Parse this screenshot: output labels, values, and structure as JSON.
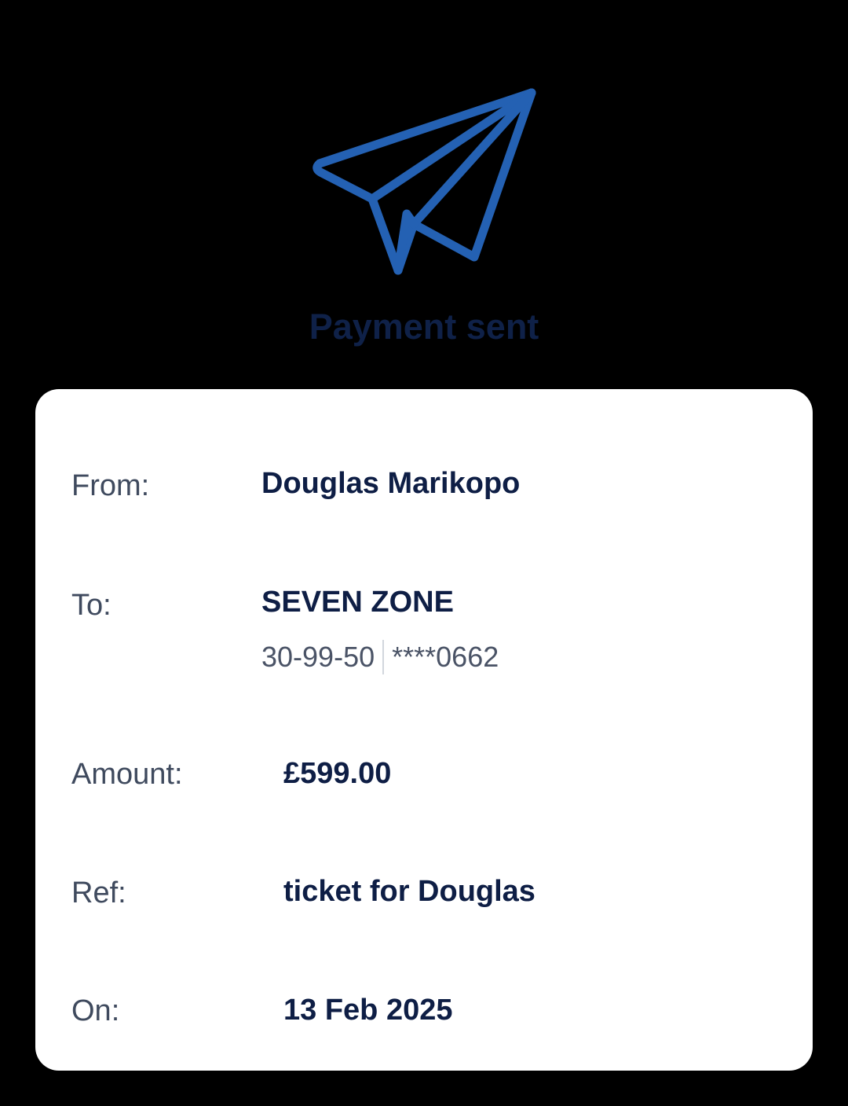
{
  "header": {
    "icon": "paper-plane-icon",
    "title": "Payment sent"
  },
  "colors": {
    "icon_blue": "#2461b3",
    "title_navy": "#0f2148",
    "value_navy": "#0e1e45",
    "label_gray": "#3f4a5e",
    "background": "#000000",
    "card": "#ffffff"
  },
  "details": {
    "from": {
      "label": "From:",
      "value": "Douglas Marikopo"
    },
    "to": {
      "label": "To:",
      "value": "SEVEN ZONE",
      "sort_code": "30-99-50",
      "account": "****0662"
    },
    "amount": {
      "label": "Amount:",
      "value": "£599.00"
    },
    "ref": {
      "label": "Ref:",
      "value": "ticket for Douglas"
    },
    "on": {
      "label": "On:",
      "value": "13 Feb 2025"
    }
  }
}
